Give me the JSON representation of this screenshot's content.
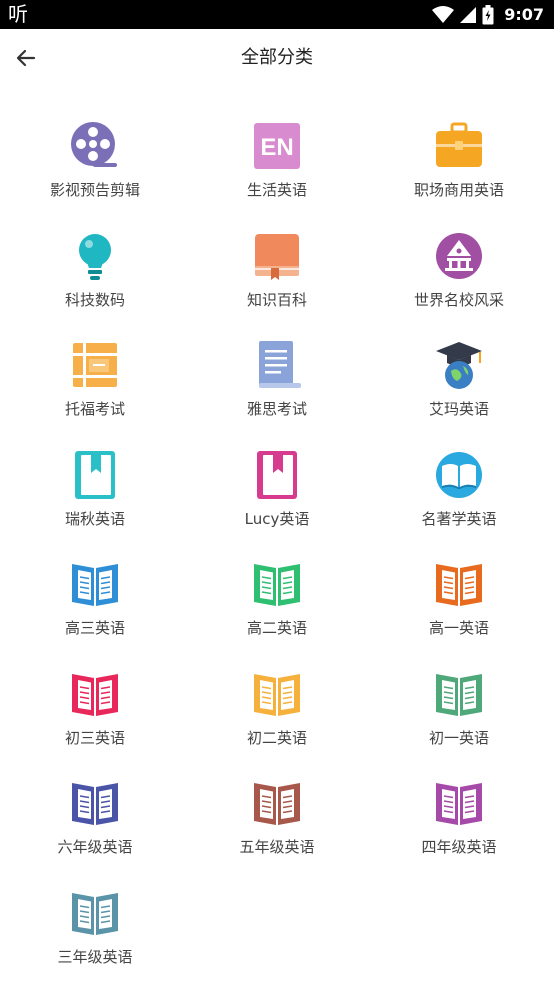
{
  "status_bar": {
    "app_glyph": "听",
    "time": "9:07",
    "icons": [
      "wifi-icon",
      "signal-icon",
      "battery-icon"
    ]
  },
  "header": {
    "title": "全部分类",
    "back_icon": "arrow-left-icon"
  },
  "categories": [
    {
      "label": "影视预告剪辑",
      "icon": "film-reel-icon",
      "color": "#7b6fb8"
    },
    {
      "label": "生活英语",
      "icon": "en-badge-icon",
      "color": "#d98bd0"
    },
    {
      "label": "职场商用英语",
      "icon": "briefcase-icon",
      "color": "#f5a623"
    },
    {
      "label": "科技数码",
      "icon": "lightbulb-icon",
      "color": "#1fb7c2"
    },
    {
      "label": "知识百科",
      "icon": "book-icon",
      "color": "#f08a5d"
    },
    {
      "label": "世界名校风采",
      "icon": "university-icon",
      "color": "#a04fa3"
    },
    {
      "label": "托福考试",
      "icon": "ticket-icon",
      "color": "#f7b049"
    },
    {
      "label": "雅思考试",
      "icon": "document-icon",
      "color": "#8aa4d9"
    },
    {
      "label": "艾玛英语",
      "icon": "graduation-globe-icon",
      "color": "#3a7fc4"
    },
    {
      "label": "瑞秋英语",
      "icon": "bookmark-book-icon",
      "color": "#2bc0c8"
    },
    {
      "label": "Lucy英语",
      "icon": "bookmark-book-icon",
      "color": "#d63b8f"
    },
    {
      "label": "名著学英语",
      "icon": "open-book-circle-icon",
      "color": "#2aa8e0"
    },
    {
      "label": "高三英语",
      "icon": "open-book-icon",
      "color": "#2e8ed6"
    },
    {
      "label": "高二英语",
      "icon": "open-book-icon",
      "color": "#2fbf71"
    },
    {
      "label": "高一英语",
      "icon": "open-book-icon",
      "color": "#e86a1f"
    },
    {
      "label": "初三英语",
      "icon": "open-book-icon",
      "color": "#e8285a"
    },
    {
      "label": "初二英语",
      "icon": "open-book-icon",
      "color": "#f5b13c"
    },
    {
      "label": "初一英语",
      "icon": "open-book-icon",
      "color": "#4fa87a"
    },
    {
      "label": "六年级英语",
      "icon": "open-book-icon",
      "color": "#4a55a8"
    },
    {
      "label": "五年级英语",
      "icon": "open-book-icon",
      "color": "#a8584a"
    },
    {
      "label": "四年级英语",
      "icon": "open-book-icon",
      "color": "#a54aa8"
    },
    {
      "label": "三年级英语",
      "icon": "open-book-icon",
      "color": "#5b93a8"
    }
  ]
}
